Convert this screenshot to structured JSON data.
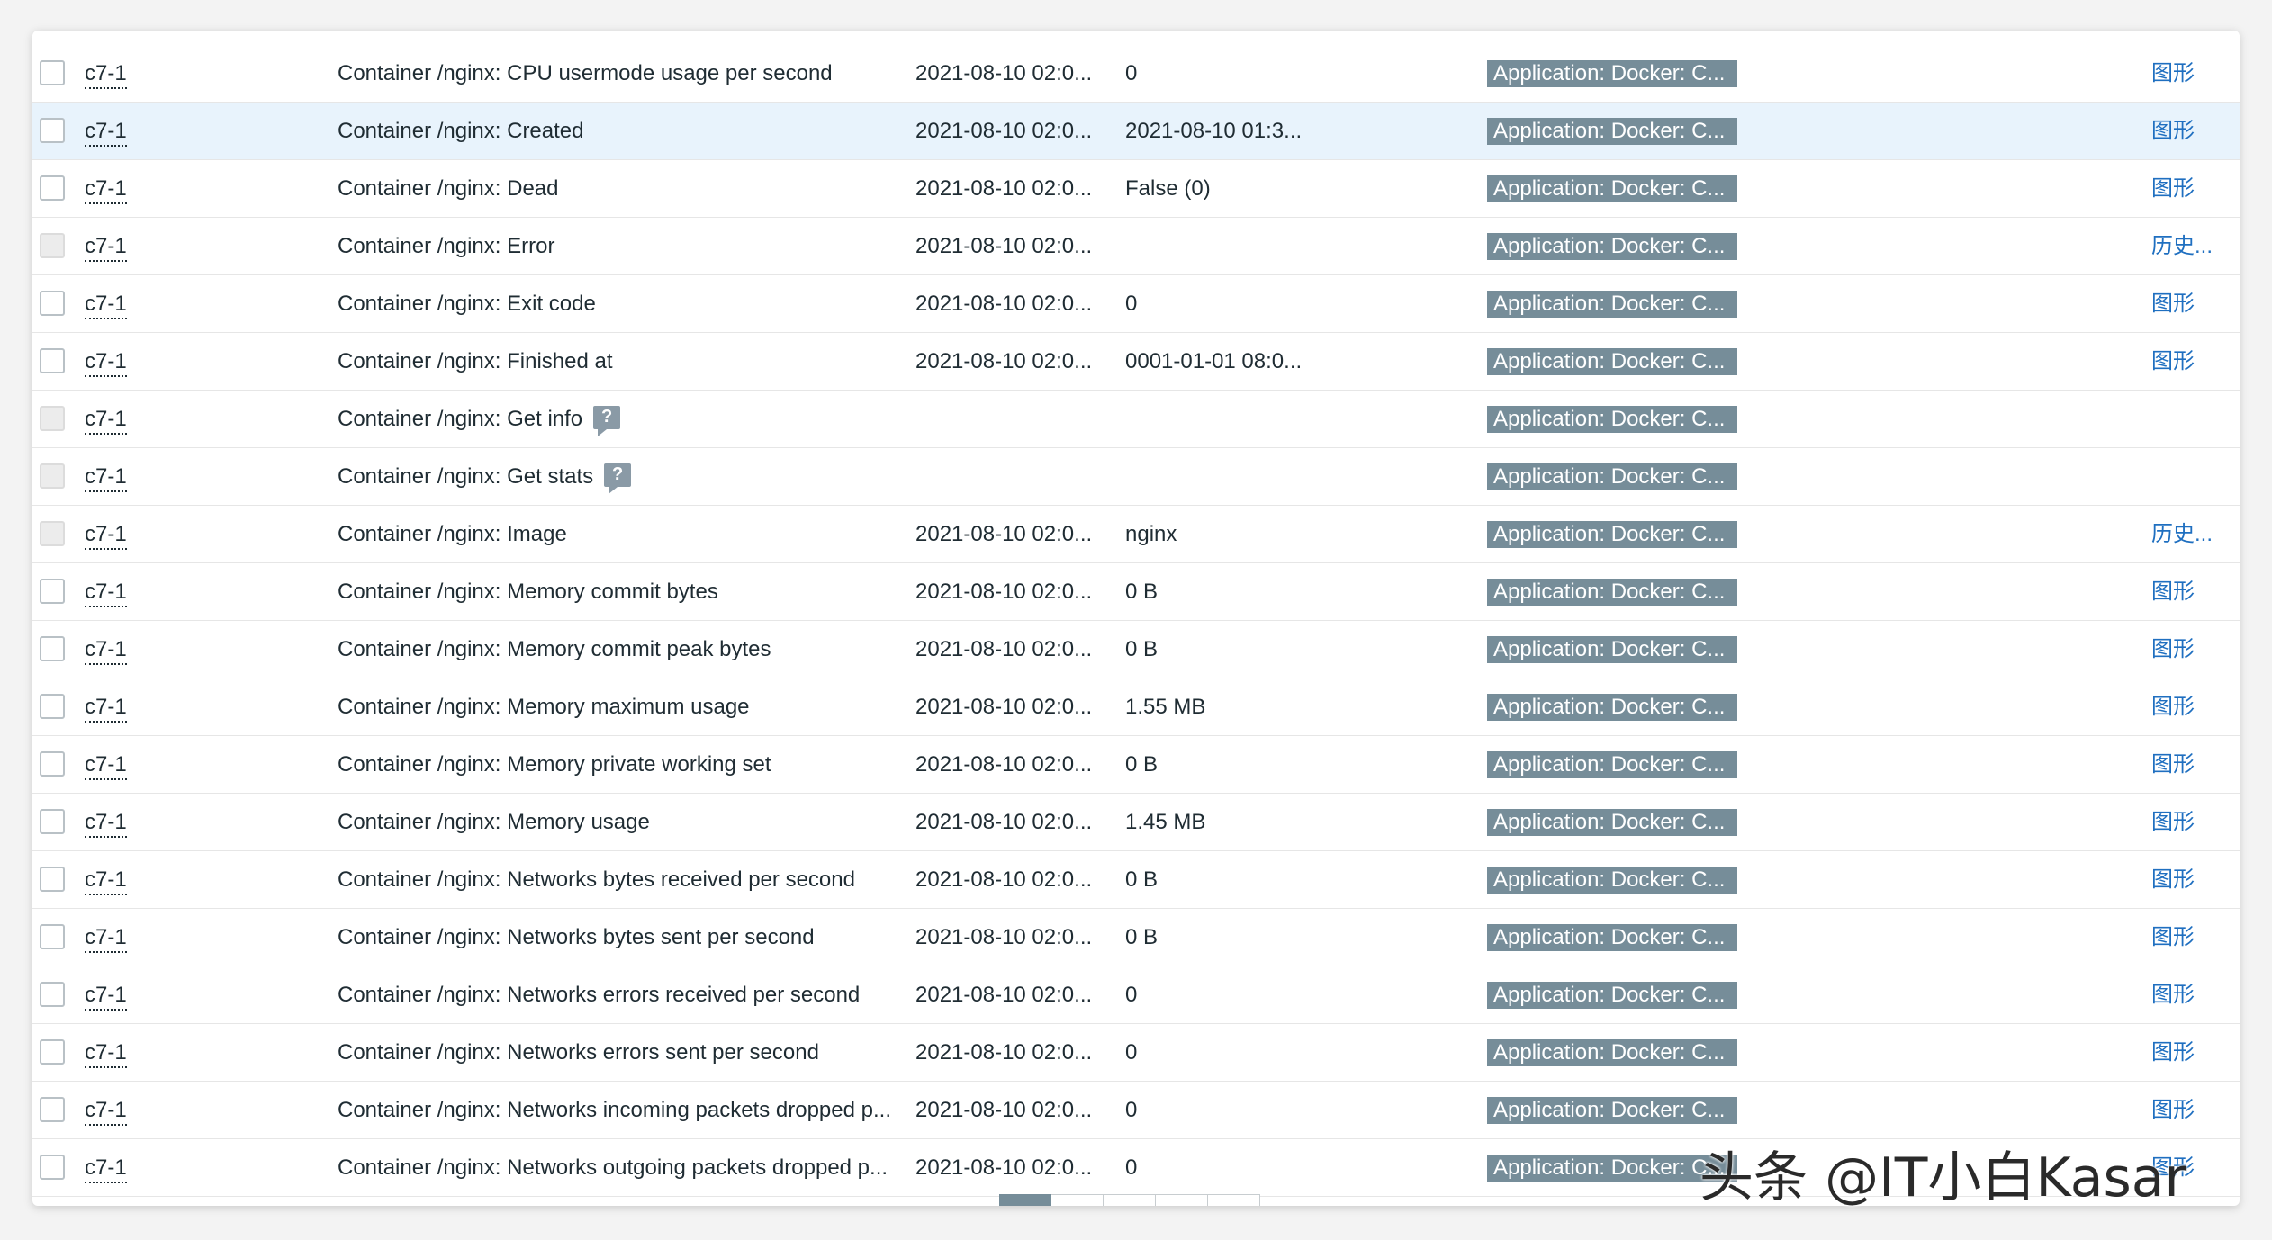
{
  "rows": [
    {
      "host": "c7-1",
      "name": "Container /nginx: CPU usermode usage per second",
      "ts": "2021-08-10 02:0...",
      "val": "0",
      "tag": "Application: Docker: C...",
      "action": "图形",
      "disabled": false,
      "help": false,
      "highlight": false
    },
    {
      "host": "c7-1",
      "name": "Container /nginx: Created",
      "ts": "2021-08-10 02:0...",
      "val": "2021-08-10 01:3...",
      "tag": "Application: Docker: C...",
      "action": "图形",
      "disabled": false,
      "help": false,
      "highlight": true
    },
    {
      "host": "c7-1",
      "name": "Container /nginx: Dead",
      "ts": "2021-08-10 02:0...",
      "val": "False (0)",
      "tag": "Application: Docker: C...",
      "action": "图形",
      "disabled": false,
      "help": false,
      "highlight": false
    },
    {
      "host": "c7-1",
      "name": "Container /nginx: Error",
      "ts": "2021-08-10 02:0...",
      "val": "",
      "tag": "Application: Docker: C...",
      "action": "历史...",
      "disabled": true,
      "help": false,
      "highlight": false
    },
    {
      "host": "c7-1",
      "name": "Container /nginx: Exit code",
      "ts": "2021-08-10 02:0...",
      "val": "0",
      "tag": "Application: Docker: C...",
      "action": "图形",
      "disabled": false,
      "help": false,
      "highlight": false
    },
    {
      "host": "c7-1",
      "name": "Container /nginx: Finished at",
      "ts": "2021-08-10 02:0...",
      "val": "0001-01-01 08:0...",
      "tag": "Application: Docker: C...",
      "action": "图形",
      "disabled": false,
      "help": false,
      "highlight": false
    },
    {
      "host": "c7-1",
      "name": "Container /nginx: Get info",
      "ts": "",
      "val": "",
      "tag": "Application: Docker: C...",
      "action": "",
      "disabled": true,
      "help": true,
      "highlight": false
    },
    {
      "host": "c7-1",
      "name": "Container /nginx: Get stats",
      "ts": "",
      "val": "",
      "tag": "Application: Docker: C...",
      "action": "",
      "disabled": true,
      "help": true,
      "highlight": false
    },
    {
      "host": "c7-1",
      "name": "Container /nginx: Image",
      "ts": "2021-08-10 02:0...",
      "val": "nginx",
      "tag": "Application: Docker: C...",
      "action": "历史...",
      "disabled": true,
      "help": false,
      "highlight": false
    },
    {
      "host": "c7-1",
      "name": "Container /nginx: Memory commit bytes",
      "ts": "2021-08-10 02:0...",
      "val": "0 B",
      "tag": "Application: Docker: C...",
      "action": "图形",
      "disabled": false,
      "help": false,
      "highlight": false
    },
    {
      "host": "c7-1",
      "name": "Container /nginx: Memory commit peak bytes",
      "ts": "2021-08-10 02:0...",
      "val": "0 B",
      "tag": "Application: Docker: C...",
      "action": "图形",
      "disabled": false,
      "help": false,
      "highlight": false
    },
    {
      "host": "c7-1",
      "name": "Container /nginx: Memory maximum usage",
      "ts": "2021-08-10 02:0...",
      "val": "1.55 MB",
      "tag": "Application: Docker: C...",
      "action": "图形",
      "disabled": false,
      "help": false,
      "highlight": false
    },
    {
      "host": "c7-1",
      "name": "Container /nginx: Memory private working set",
      "ts": "2021-08-10 02:0...",
      "val": "0 B",
      "tag": "Application: Docker: C...",
      "action": "图形",
      "disabled": false,
      "help": false,
      "highlight": false
    },
    {
      "host": "c7-1",
      "name": "Container /nginx: Memory usage",
      "ts": "2021-08-10 02:0...",
      "val": "1.45 MB",
      "tag": "Application: Docker: C...",
      "action": "图形",
      "disabled": false,
      "help": false,
      "highlight": false
    },
    {
      "host": "c7-1",
      "name": "Container /nginx: Networks bytes received per second",
      "ts": "2021-08-10 02:0...",
      "val": "0 B",
      "tag": "Application: Docker: C...",
      "action": "图形",
      "disabled": false,
      "help": false,
      "highlight": false
    },
    {
      "host": "c7-1",
      "name": "Container /nginx: Networks bytes sent per second",
      "ts": "2021-08-10 02:0...",
      "val": "0 B",
      "tag": "Application: Docker: C...",
      "action": "图形",
      "disabled": false,
      "help": false,
      "highlight": false
    },
    {
      "host": "c7-1",
      "name": "Container /nginx: Networks errors received per second",
      "ts": "2021-08-10 02:0...",
      "val": "0",
      "tag": "Application: Docker: C...",
      "action": "图形",
      "disabled": false,
      "help": false,
      "highlight": false
    },
    {
      "host": "c7-1",
      "name": "Container /nginx: Networks errors sent per second",
      "ts": "2021-08-10 02:0...",
      "val": "0",
      "tag": "Application: Docker: C...",
      "action": "图形",
      "disabled": false,
      "help": false,
      "highlight": false
    },
    {
      "host": "c7-1",
      "name": "Container /nginx: Networks incoming packets dropped p...",
      "ts": "2021-08-10 02:0...",
      "val": "0",
      "tag": "Application: Docker: C...",
      "action": "图形",
      "disabled": false,
      "help": false,
      "highlight": false
    },
    {
      "host": "c7-1",
      "name": "Container /nginx: Networks outgoing packets dropped p...",
      "ts": "2021-08-10 02:0...",
      "val": "0",
      "tag": "Application: Docker: C...",
      "action": "图形",
      "disabled": false,
      "help": false,
      "highlight": false
    }
  ],
  "help_icon_label": "?",
  "watermark": "头条 @IT小白Kasar"
}
